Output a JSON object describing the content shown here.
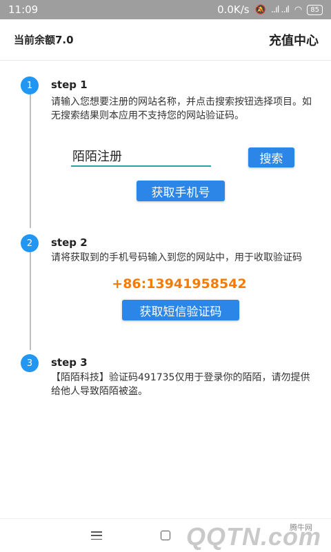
{
  "status_bar": {
    "time": "11:09",
    "speed": "0.0K/s",
    "signal": "..ıl ..ıl",
    "battery": "85"
  },
  "header": {
    "balance": "当前余额7.0",
    "recharge": "充值中心"
  },
  "steps": [
    {
      "number": "1",
      "title": "step 1",
      "desc": "请输入您想要注册的网站名称，并点击搜索按钮选择项目。如无搜索结果则本应用不支持您的网站验证码。",
      "input_value": "陌陌注册",
      "search_label": "搜索",
      "get_phone_label": "获取手机号"
    },
    {
      "number": "2",
      "title": "step 2",
      "desc": "请将获取到的手机号码输入到您的网站中，用于收取验证码",
      "phone": "+86:13941958542",
      "get_sms_label": "获取短信验证码"
    },
    {
      "number": "3",
      "title": "step 3",
      "desc": "【陌陌科技】验证码491735仅用于登录你的陌陌，请勿提供给他人导致陌陌被盗。"
    }
  ],
  "watermark": {
    "site": "QQTN.com",
    "brand": "腾牛网"
  },
  "colors": {
    "accent": "#2b86e8",
    "badge": "#2196f3",
    "phone": "#f57c00",
    "input_underline": "#26a69a"
  }
}
